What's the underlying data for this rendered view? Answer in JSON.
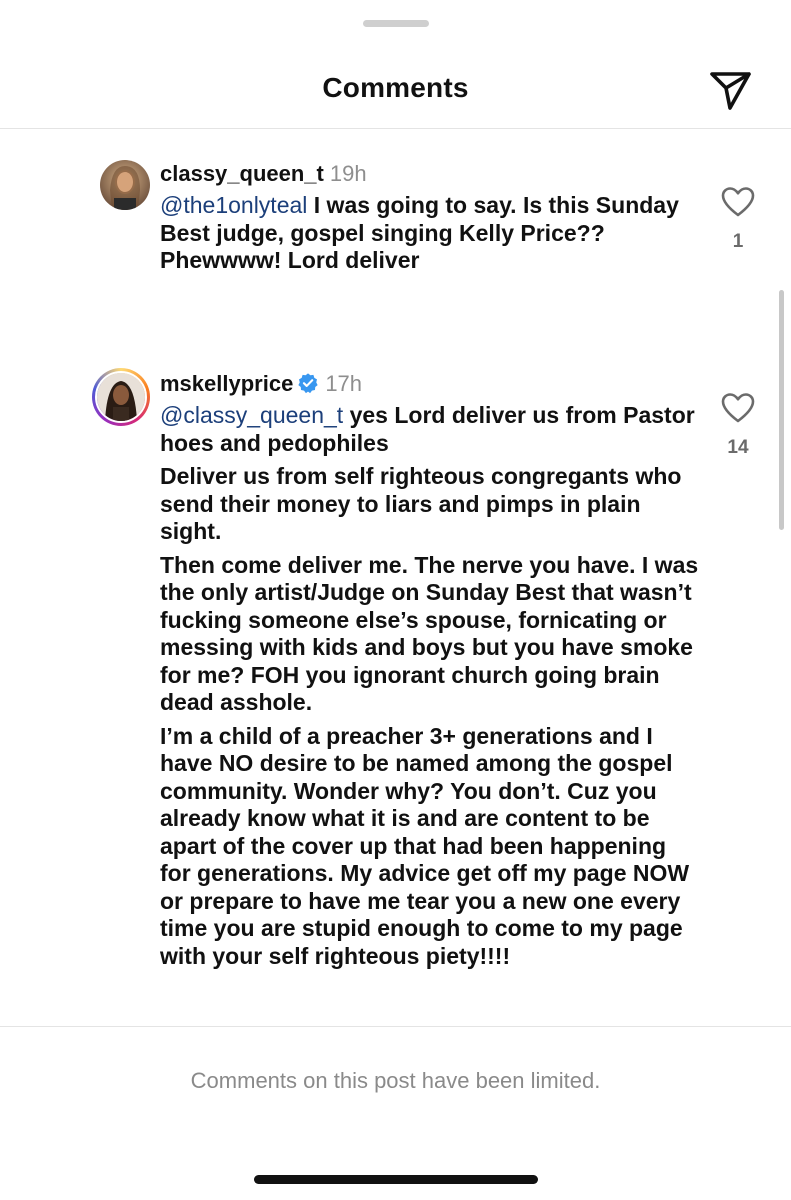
{
  "header": {
    "title": "Comments",
    "share_icon": "paper-plane-icon"
  },
  "comments": [
    {
      "username": "classy_queen_t",
      "timestamp": "19h",
      "verified": false,
      "mention": "@the1onlyteal",
      "text": " I was going to say. Is this Sunday Best judge, gospel singing Kelly Price?? Phewwww! Lord deliver",
      "likes": "1"
    },
    {
      "username": "mskellyprice",
      "timestamp": "17h",
      "verified": true,
      "mention": "@classy_queen_t",
      "paragraphs": [
        " yes Lord deliver us from Pastor hoes and pedophiles",
        "Deliver us from self righteous congregants who send their money to liars and pimps in plain sight.",
        "Then come deliver me. The nerve you have. I was the only artist/Judge on Sunday Best that wasn’t fucking someone else’s spouse, fornicating or messing with kids and boys but you have smoke for me? FOH you ignorant church going brain dead asshole.",
        "I’m a child of a preacher 3+ generations and I have NO desire to be named among the gospel community. Wonder why? You don’t. Cuz you already know what it is and are content to be apart of the  cover up that had been happening for generations. My advice get off my page NOW or prepare to have me tear you a new one every time you are stupid enough to come to my page with your self righteous piety!!!!"
      ],
      "likes": "14"
    }
  ],
  "footer": {
    "limited_note": "Comments on this post have been limited."
  },
  "colors": {
    "mention": "#1c3f7a",
    "verified": "#3897f0",
    "muted": "#8e8e8e"
  }
}
